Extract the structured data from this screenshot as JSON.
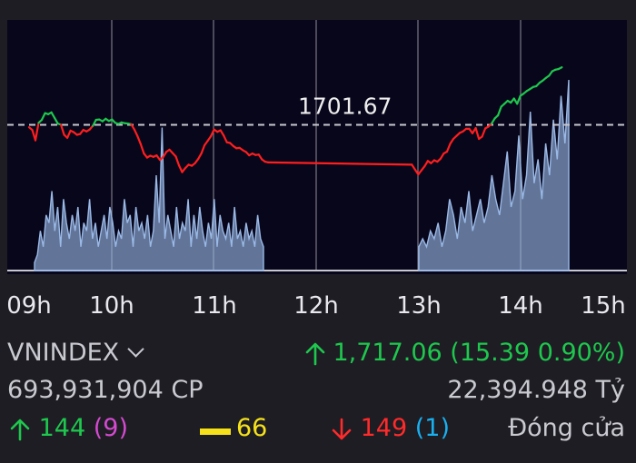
{
  "chart": {
    "reference_label": "1701.67",
    "colors": {
      "up": "#1ec84e",
      "down": "#ff1e1e",
      "volume": "#9ab9e6",
      "reference": "#c8c8d0",
      "grid": "#ffffff"
    }
  },
  "chart_data": {
    "type": "line",
    "title": "",
    "xlabel": "",
    "ylabel": "",
    "reference_value": 1701.67,
    "x_ticks": [
      "09h",
      "10h",
      "11h",
      "12h",
      "13h",
      "14h",
      "15h"
    ],
    "series": [
      {
        "kind": "price",
        "points": [
          [
            "09:00",
            1701.0
          ],
          [
            "09:02",
            1700.3
          ],
          [
            "09:04",
            1697.5
          ],
          [
            "09:06",
            1702.2
          ],
          [
            "09:08",
            1703.0
          ],
          [
            "09:10",
            1704.8
          ],
          [
            "09:12",
            1704.5
          ],
          [
            "09:14",
            1705.0
          ],
          [
            "09:16",
            1703.5
          ],
          [
            "09:18",
            1702.0
          ],
          [
            "09:20",
            1701.7
          ],
          [
            "09:22",
            1699.0
          ],
          [
            "09:24",
            1698.2
          ],
          [
            "09:26",
            1700.1
          ],
          [
            "09:28",
            1699.7
          ],
          [
            "09:30",
            1699.0
          ],
          [
            "09:32",
            1699.2
          ],
          [
            "09:34",
            1700.3
          ],
          [
            "09:36",
            1699.9
          ],
          [
            "09:38",
            1700.4
          ],
          [
            "09:40",
            1701.4
          ],
          [
            "09:42",
            1703.0
          ],
          [
            "09:44",
            1703.1
          ],
          [
            "09:46",
            1702.6
          ],
          [
            "09:48",
            1703.3
          ],
          [
            "09:50",
            1702.7
          ],
          [
            "09:52",
            1703.1
          ],
          [
            "09:54",
            1702.2
          ],
          [
            "09:56",
            1701.9
          ],
          [
            "09:58",
            1702.3
          ],
          [
            "10:00",
            1702.1
          ],
          [
            "10:02",
            1702.0
          ],
          [
            "10:04",
            1701.8
          ],
          [
            "10:06",
            1700.4
          ],
          [
            "10:08",
            1698.6
          ],
          [
            "10:10",
            1696.5
          ],
          [
            "10:12",
            1694.0
          ],
          [
            "10:14",
            1692.9
          ],
          [
            "10:16",
            1693.4
          ],
          [
            "10:18",
            1693.1
          ],
          [
            "10:20",
            1693.5
          ],
          [
            "10:22",
            1692.3
          ],
          [
            "10:24",
            1693.0
          ],
          [
            "10:26",
            1694.4
          ],
          [
            "10:28",
            1695.0
          ],
          [
            "10:30",
            1694.1
          ],
          [
            "10:32",
            1693.2
          ],
          [
            "10:34",
            1690.8
          ],
          [
            "10:36",
            1689.0
          ],
          [
            "10:38",
            1690.1
          ],
          [
            "10:40",
            1691.0
          ],
          [
            "10:42",
            1690.7
          ],
          [
            "10:44",
            1691.4
          ],
          [
            "10:46",
            1692.5
          ],
          [
            "10:48",
            1694.0
          ],
          [
            "10:50",
            1696.2
          ],
          [
            "10:52",
            1697.4
          ],
          [
            "10:54",
            1698.6
          ],
          [
            "10:56",
            1700.4
          ],
          [
            "10:58",
            1699.8
          ],
          [
            "11:00",
            1700.2
          ],
          [
            "11:02",
            1698.8
          ],
          [
            "11:04",
            1697.0
          ],
          [
            "11:06",
            1696.8
          ],
          [
            "11:08",
            1696.0
          ],
          [
            "11:10",
            1695.4
          ],
          [
            "11:12",
            1695.5
          ],
          [
            "11:14",
            1694.9
          ],
          [
            "11:16",
            1694.4
          ],
          [
            "11:18",
            1693.5
          ],
          [
            "11:20",
            1694.0
          ],
          [
            "11:22",
            1693.6
          ],
          [
            "11:24",
            1693.7
          ],
          [
            "11:26",
            1692.4
          ],
          [
            "11:28",
            1691.8
          ],
          [
            "11:30",
            1691.6
          ],
          [
            "13:00",
            1691.0
          ],
          [
            "13:02",
            1689.7
          ],
          [
            "13:04",
            1688.4
          ],
          [
            "13:06",
            1689.5
          ],
          [
            "13:08",
            1690.6
          ],
          [
            "13:10",
            1692.0
          ],
          [
            "13:12",
            1691.4
          ],
          [
            "13:14",
            1692.2
          ],
          [
            "13:16",
            1691.8
          ],
          [
            "13:18",
            1692.6
          ],
          [
            "13:20",
            1694.0
          ],
          [
            "13:22",
            1694.5
          ],
          [
            "13:24",
            1696.6
          ],
          [
            "13:26",
            1697.9
          ],
          [
            "13:28",
            1698.7
          ],
          [
            "13:30",
            1699.5
          ],
          [
            "13:32",
            1699.9
          ],
          [
            "13:34",
            1700.6
          ],
          [
            "13:36",
            1700.6
          ],
          [
            "13:38",
            1699.4
          ],
          [
            "13:40",
            1700.8
          ],
          [
            "13:42",
            1697.9
          ],
          [
            "13:44",
            1698.5
          ],
          [
            "13:46",
            1700.7
          ],
          [
            "13:48",
            1701.2
          ],
          [
            "13:50",
            1702.0
          ],
          [
            "13:52",
            1703.4
          ],
          [
            "13:54",
            1704.2
          ],
          [
            "13:56",
            1706.5
          ],
          [
            "13:58",
            1707.3
          ],
          [
            "14:00",
            1708.1
          ],
          [
            "14:02",
            1707.6
          ],
          [
            "14:04",
            1708.7
          ],
          [
            "14:06",
            1707.3
          ],
          [
            "14:08",
            1709.4
          ],
          [
            "14:10",
            1710.0
          ],
          [
            "14:12",
            1710.7
          ],
          [
            "14:14",
            1711.2
          ],
          [
            "14:16",
            1711.8
          ],
          [
            "14:18",
            1712.0
          ],
          [
            "14:20",
            1712.9
          ],
          [
            "14:22",
            1713.5
          ],
          [
            "14:24",
            1714.2
          ],
          [
            "14:26",
            1714.8
          ],
          [
            "14:28",
            1716.0
          ],
          [
            "14:30",
            1716.4
          ],
          [
            "14:32",
            1716.6
          ],
          [
            "14:34",
            1717.06
          ]
        ]
      },
      {
        "kind": "volume",
        "values": [
          1,
          2,
          5,
          3,
          7,
          6,
          10,
          5,
          8,
          3,
          9,
          6,
          4,
          7,
          5,
          8,
          3,
          6,
          5,
          9,
          4,
          6,
          3,
          5,
          7,
          4,
          8,
          6,
          3,
          5,
          4,
          9,
          6,
          7,
          3,
          8,
          5,
          6,
          4,
          7,
          3,
          5,
          12,
          6,
          18,
          4,
          7,
          5,
          3,
          8,
          4,
          6,
          5,
          9,
          3,
          7,
          4,
          8,
          5,
          3,
          6,
          4,
          9,
          3,
          7,
          5,
          4,
          6,
          3,
          8,
          4,
          5,
          3,
          6,
          4,
          5,
          3,
          7,
          4,
          3,
          3,
          4,
          3,
          5,
          4,
          6,
          3,
          5,
          9,
          7,
          4,
          8,
          6,
          10,
          5,
          7,
          9,
          6,
          8,
          12,
          9,
          7,
          11,
          15,
          8,
          10,
          17,
          9,
          12,
          20,
          11,
          14,
          9,
          16,
          12,
          19,
          14,
          22,
          16,
          24
        ]
      }
    ]
  },
  "summary": {
    "index_name": "VNINDEX",
    "index_value": "1,717.06",
    "index_change": "(15.39 0.90%)",
    "volume": "693,931,904 CP",
    "value": "22,394.948 Tỷ",
    "advancers": "144",
    "ceiling": "(9)",
    "unchanged": "66",
    "decliners": "149",
    "floor": "(1)",
    "status": "Đóng cửa"
  }
}
